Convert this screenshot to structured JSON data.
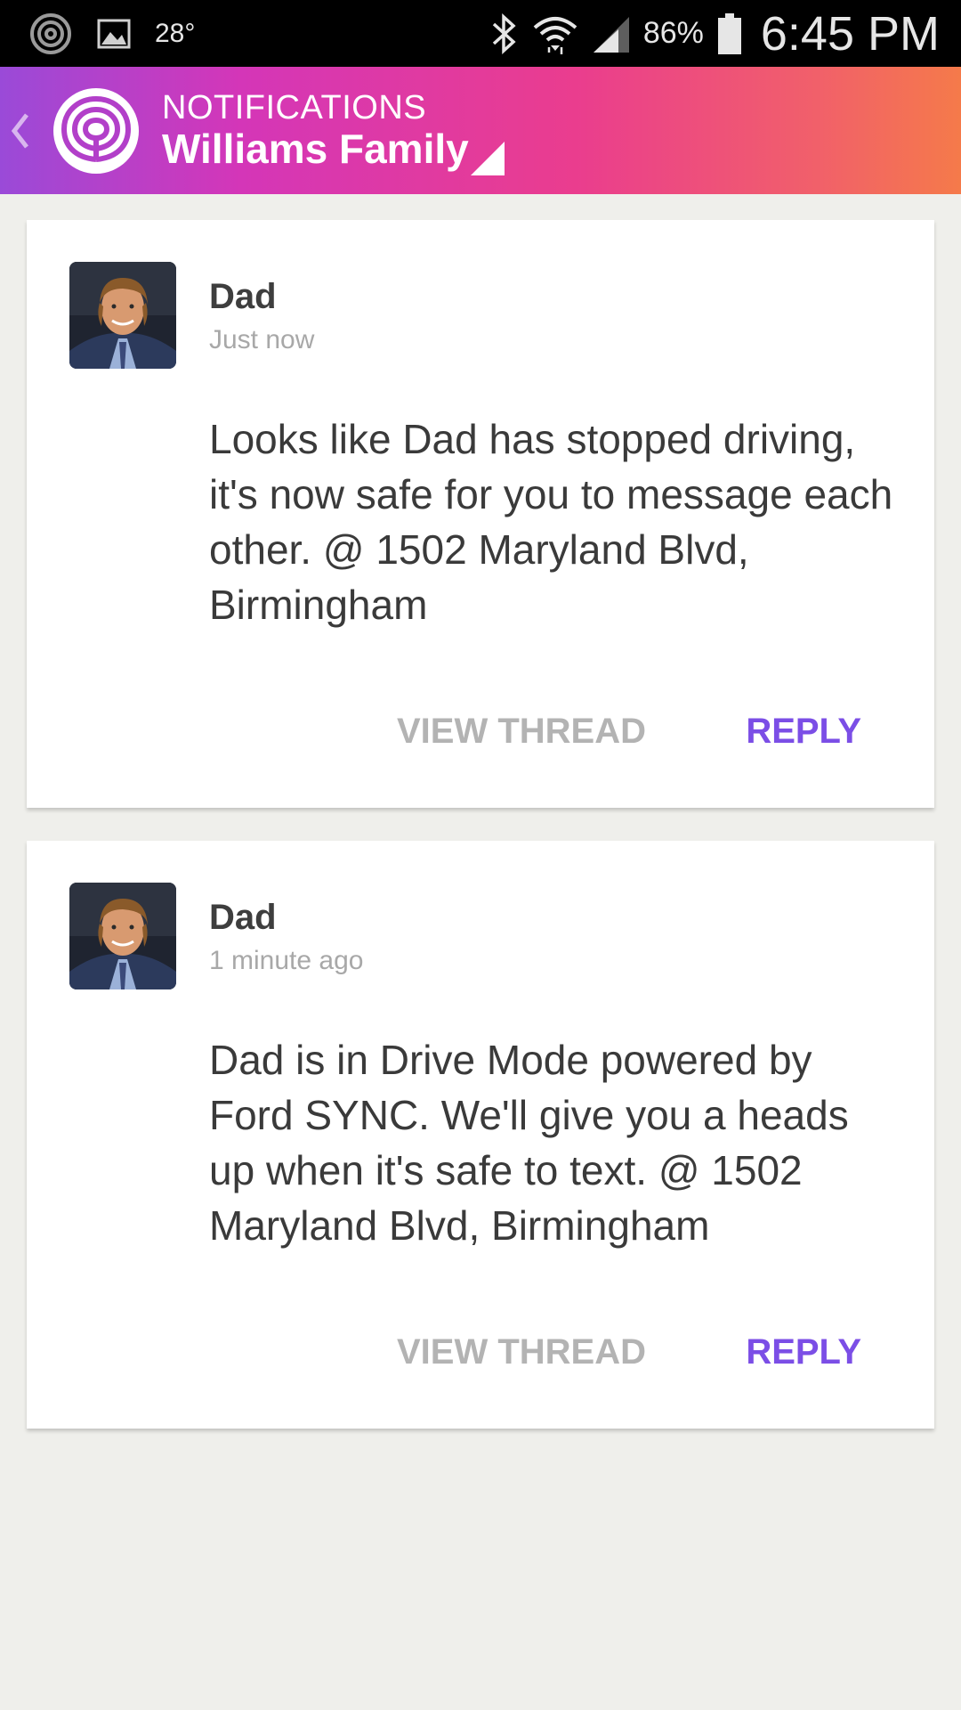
{
  "status_bar": {
    "temperature": "28°",
    "battery": "86%",
    "time": "6:45 PM"
  },
  "header": {
    "subtitle": "NOTIFICATIONS",
    "title": "Williams Family"
  },
  "notifications": [
    {
      "sender": "Dad",
      "time": "Just now",
      "message": "Looks like Dad has stopped driving, it's now safe for you to message each other. @ 1502 Maryland Blvd, Birmingham",
      "view_thread_label": "VIEW THREAD",
      "reply_label": "REPLY"
    },
    {
      "sender": "Dad",
      "time": "1 minute ago",
      "message": "Dad is in Drive Mode powered by Ford SYNC. We'll give you a heads up when it's safe to text. @ 1502 Maryland Blvd, Birmingham",
      "view_thread_label": "VIEW THREAD",
      "reply_label": "REPLY"
    }
  ],
  "colors": {
    "accent": "#7b4ee6",
    "header_gradient_start": "#9a4ad8",
    "header_gradient_end": "#f57a4a",
    "muted": "#b3b3b3"
  },
  "icons": {
    "status_left": [
      "life360-icon",
      "image-icon"
    ],
    "status_right": [
      "bluetooth-icon",
      "wifi-icon",
      "signal-icon",
      "battery-icon"
    ],
    "header": [
      "back-chevron-icon",
      "life360-logo-icon",
      "dropdown-triangle-icon"
    ]
  }
}
